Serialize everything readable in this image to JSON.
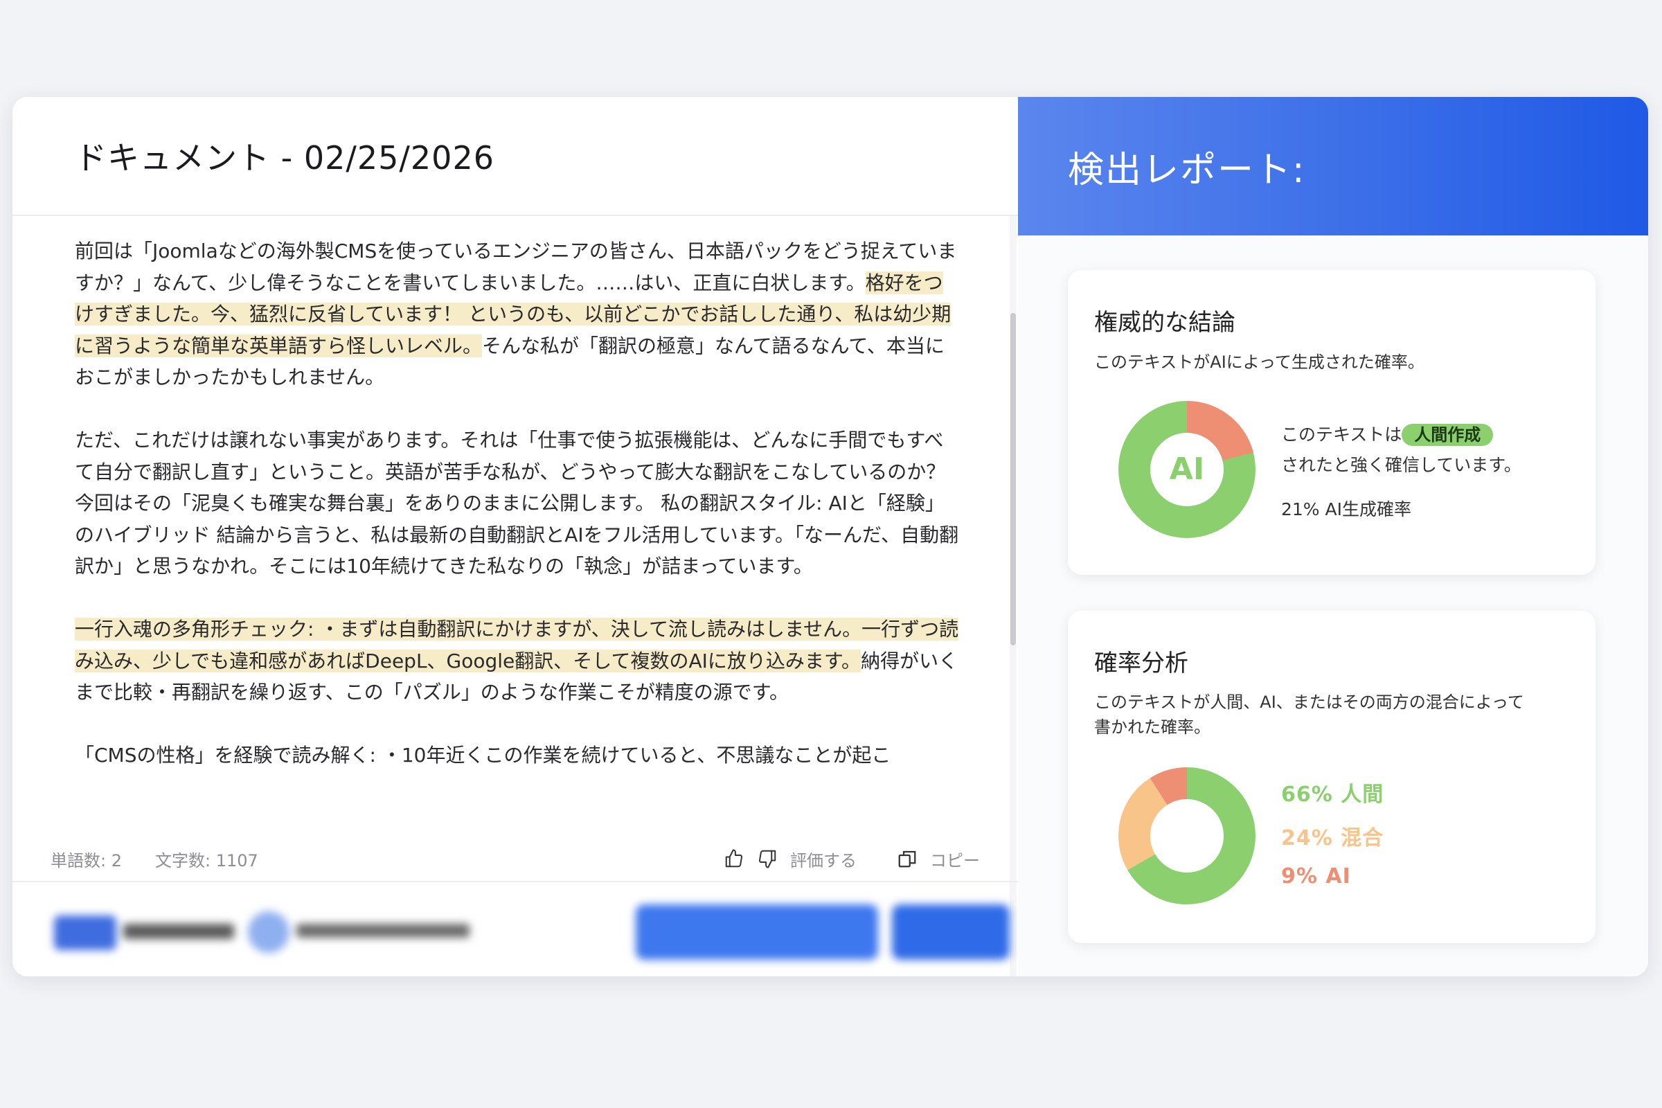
{
  "document": {
    "title": "ドキュメント - 02/25/2026",
    "paragraphs": [
      [
        {
          "text": "前回は「Joomlaなどの海外製CMSを使っているエンジニアの皆さん、日本語パックをどう捉えていますか？」なんて、少し偉そうなことを書いてしまいました。……はい、正直に白状します。",
          "highlight": false
        },
        {
          "text": "格好をつけすぎました。今、猛烈に反省しています！ というのも、以前どこかでお話しした通り、私は幼少期に習うような簡単な英単語すら怪しいレベル。",
          "highlight": true
        },
        {
          "text": "そんな私が「翻訳の極意」なんて語るなんて、本当におこがましかったかもしれません。",
          "highlight": false
        }
      ],
      [
        {
          "text": "ただ、これだけは譲れない事実があります。それは「仕事で使う拡張機能は、どんなに手間でもすべて自分で翻訳し直す」ということ。英語が苦手な私が、どうやって膨大な翻訳をこなしているのか？今回はその「泥臭くも確実な舞台裏」をありのままに公開します。 私の翻訳スタイル: AIと「経験」のハイブリッド 結論から言うと、私は最新の自動翻訳とAIをフル活用しています。「なーんだ、自動翻訳か」と思うなかれ。そこには10年続けてきた私なりの「執念」が詰まっています。",
          "highlight": false
        }
      ],
      [
        {
          "text": "一行入魂の多角形チェック: ・まずは自動翻訳にかけますが、決して流し読みはしません。一行ずつ読み込み、少しでも違和感があればDeepL、Google翻訳、そして複数のAIに放り込みます。",
          "highlight": true
        },
        {
          "text": "納得がいくまで比較・再翻訳を繰り返す、この「パズル」のような作業こそが精度の源です。",
          "highlight": false
        }
      ],
      [
        {
          "text": "「CMSの性格」を経験で読み解く: ・10年近くこの作業を続けていると、不思議なことが起こ",
          "highlight": false
        }
      ]
    ],
    "footer": {
      "words": "単語数: 2",
      "chars": "文字数: 1107",
      "rate": "評価する",
      "copy": "コピー"
    }
  },
  "report": {
    "title": "検出レポート:",
    "conclusion": {
      "heading": "権威的な結論",
      "subtitle": "このテキストがAIによって生成された確率。",
      "donut_label": "AI",
      "verdict_prefix": "このテキストは",
      "verdict_badge": "人間作成",
      "verdict_suffix": "されたと強く確信しています。",
      "ai_probability": "21% AI生成確率",
      "ai_fraction": 0.21
    },
    "analysis": {
      "heading": "確率分析",
      "subtitle_line1": "このテキストが人間、AI、またはその両方の混合によって",
      "subtitle_line2": "書かれた確率。",
      "items": [
        {
          "label": "66% 人間",
          "value": 66,
          "color": "#8ccf6f"
        },
        {
          "label": "24% 混合",
          "value": 24,
          "color": "#f8c48a"
        },
        {
          "label": "9% AI",
          "value": 9,
          "color": "#ee8f74"
        }
      ]
    }
  },
  "colors": {
    "human": "#8ccf6f",
    "ai": "#ee8f74",
    "mixed": "#f8c48a",
    "header_gradient_start": "#5b86ee",
    "header_gradient_end": "#1f59e6",
    "highlight": "#f7ecc8"
  },
  "icons": [
    "thumbs-up-icon",
    "thumbs-down-icon",
    "copy-icon"
  ]
}
